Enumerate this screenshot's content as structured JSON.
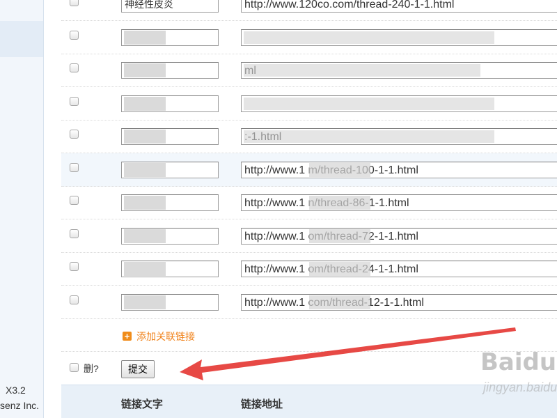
{
  "sidebar": {
    "version": "X3.2",
    "copyright": "senz Inc."
  },
  "rows": [
    {
      "text": "神经性皮炎",
      "url": "http://www.120co.com/thread-240-1-1.html",
      "highlight": false
    },
    {
      "text": "",
      "url": "",
      "highlight": false
    },
    {
      "text": "",
      "url": "ml",
      "highlight": false
    },
    {
      "text": "",
      "url": "",
      "highlight": false
    },
    {
      "text": "",
      "url": ":-1.html",
      "highlight": false
    },
    {
      "text": "",
      "url": "http://www.1            m/thread-100-1-1.html",
      "highlight": true
    },
    {
      "text": "",
      "url": "http://www.1            n/thread-86-1-1.html",
      "highlight": false
    },
    {
      "text": "",
      "url": "http://www.1            om/thread-72-1-1.html",
      "highlight": false
    },
    {
      "text": "",
      "url": "http://www.1            om/thread-24-1-1.html",
      "highlight": false
    },
    {
      "text": "",
      "url": "http://www.1            com/thread-12-1-1.html",
      "highlight": false
    }
  ],
  "add_link": {
    "icon": "plus-icon",
    "label": "添加关联链接"
  },
  "actions": {
    "delete_label": "删?",
    "submit_label": "提交"
  },
  "table_header": {
    "col_text": "链接文字",
    "col_url": "链接地址"
  },
  "watermark": {
    "brand": "Baidu",
    "sub": "jingyan.baidu"
  },
  "colors": {
    "accent_orange": "#f0821a",
    "header_bg": "#e8f0f8",
    "highlight_row": "#f2f7fc",
    "annotation_arrow": "#e53935"
  }
}
